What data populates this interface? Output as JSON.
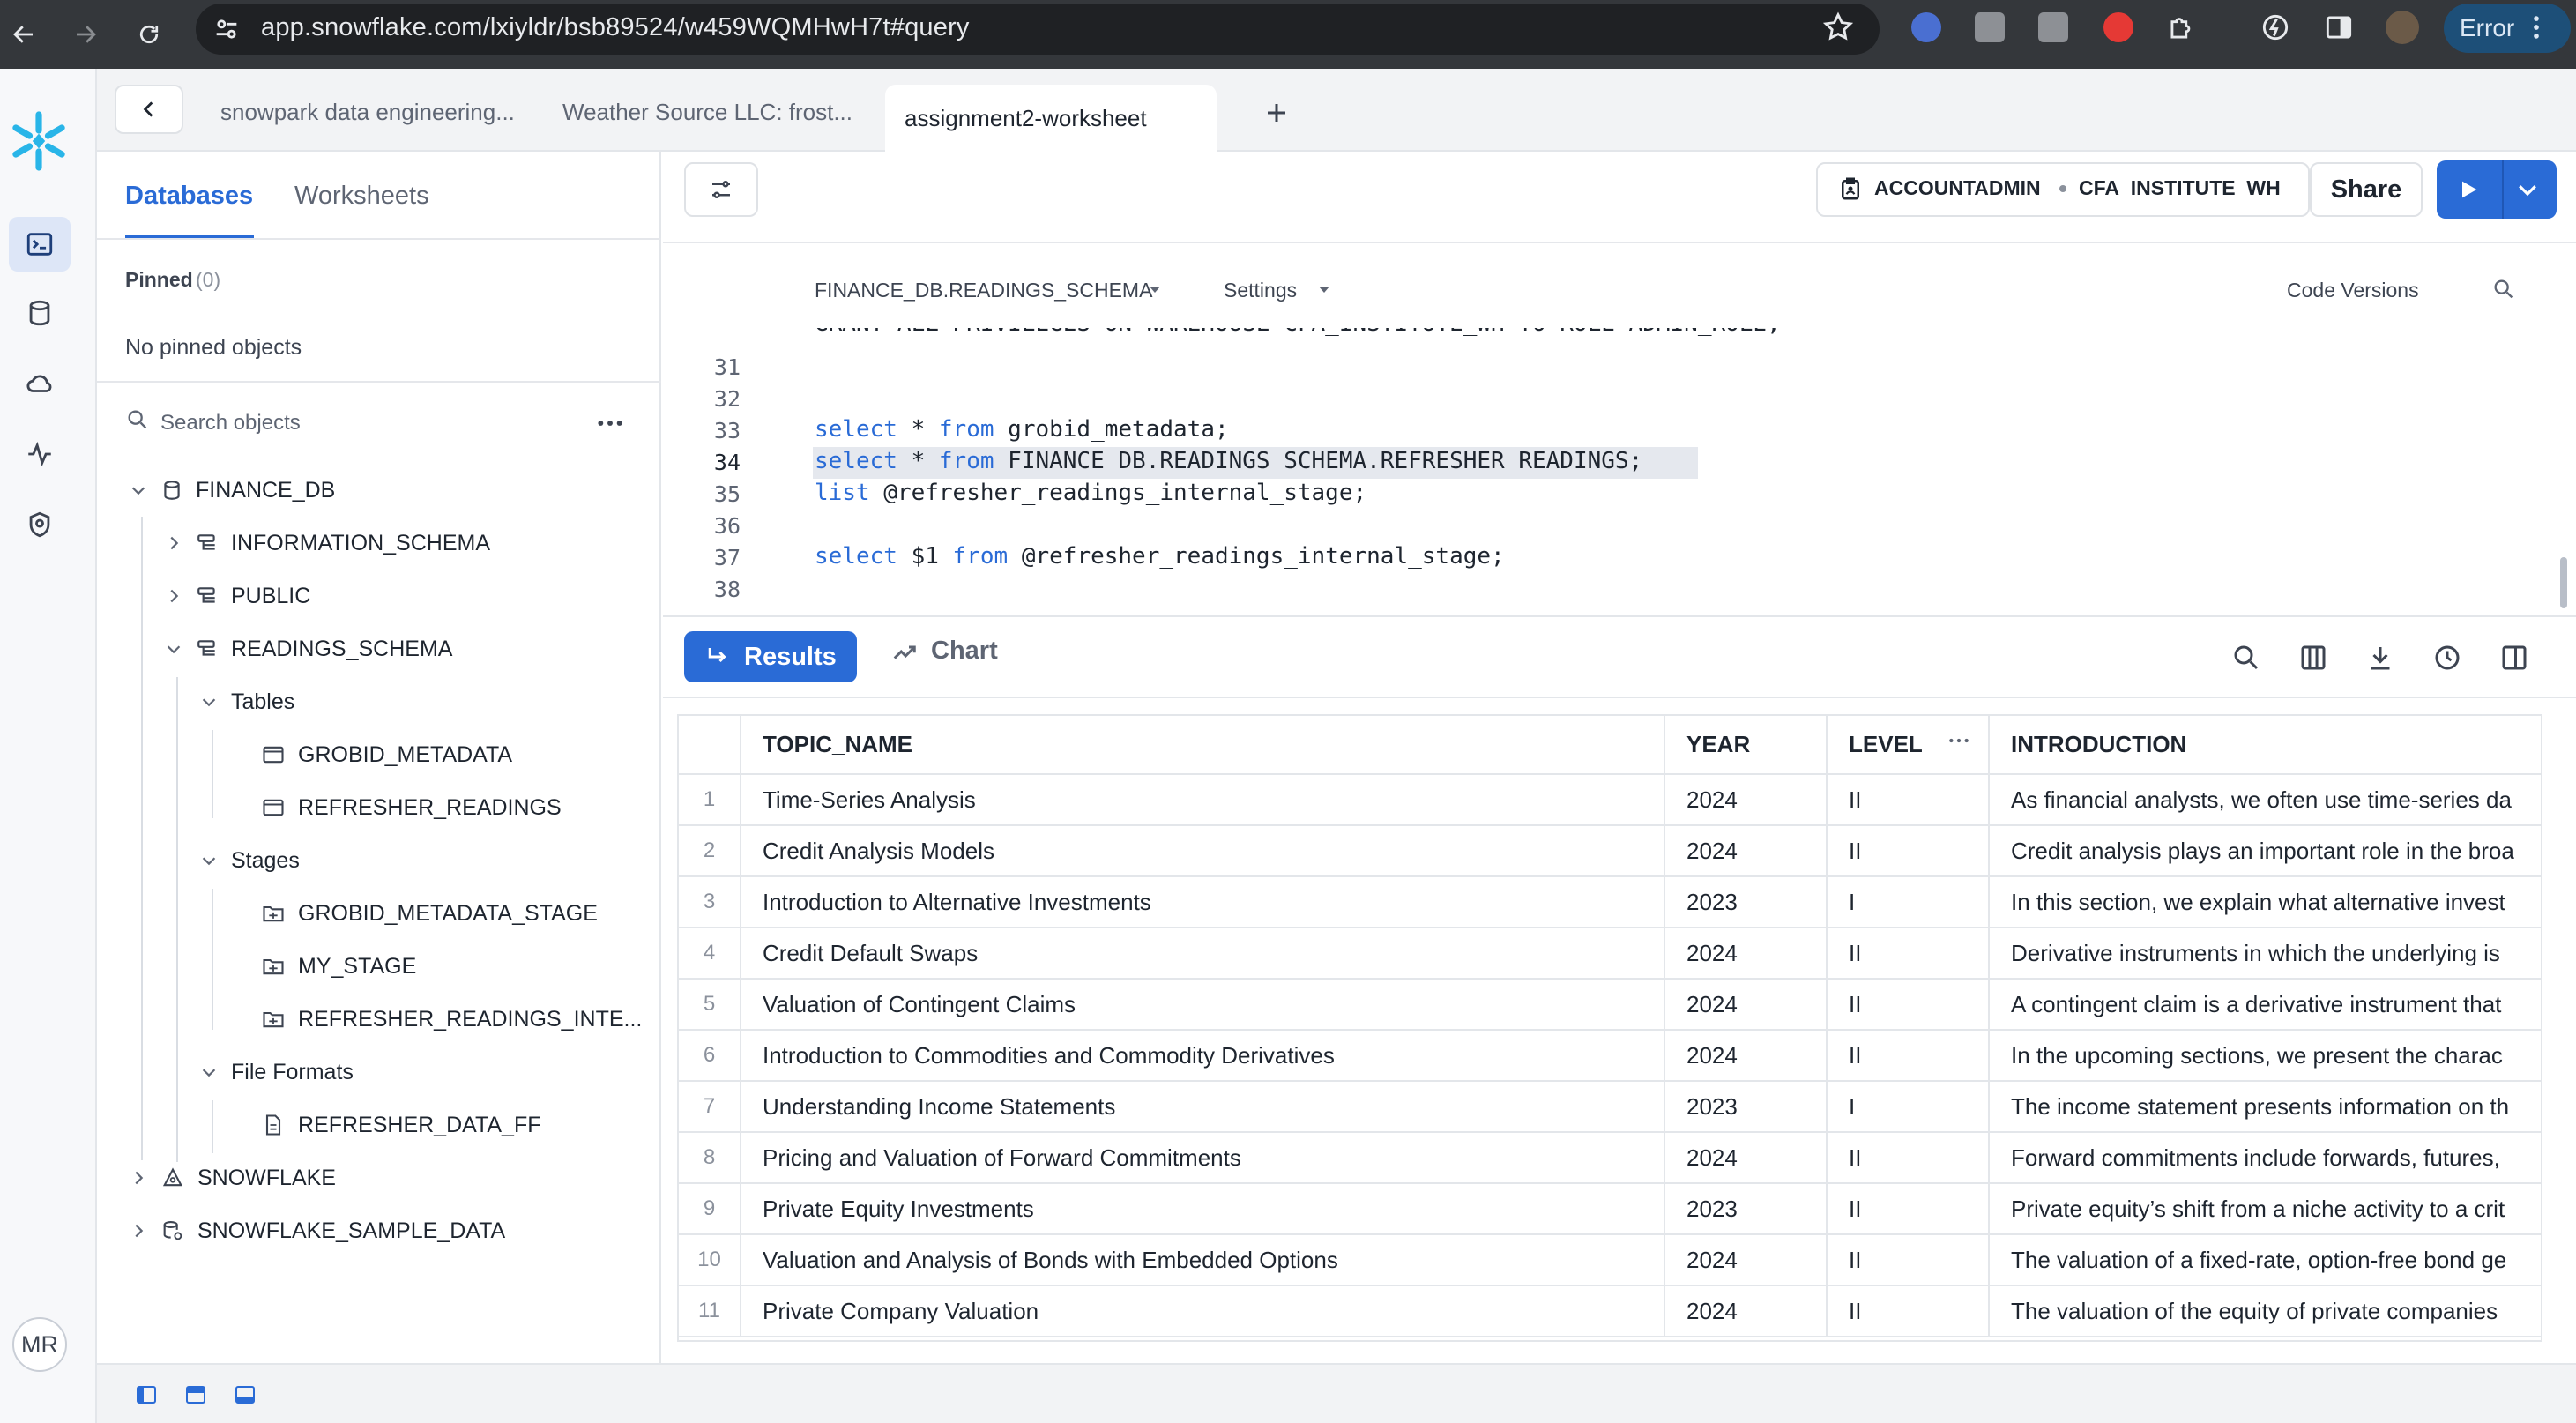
{
  "browser": {
    "url": "app.snowflake.com/lxiyldr/bsb89524/w459WQMHwH7t#query",
    "error_label": "Error"
  },
  "tabs": [
    {
      "label": "snowpark data engineering..."
    },
    {
      "label": "Weather Source LLC: frost..."
    },
    {
      "label": "assignment2-worksheet"
    }
  ],
  "sidebar": {
    "tab_databases": "Databases",
    "tab_worksheets": "Worksheets",
    "pinned_label": "Pinned",
    "pinned_count": "(0)",
    "no_pinned": "No pinned objects",
    "search_placeholder": "Search objects",
    "tree": {
      "finance_db": "FINANCE_DB",
      "information_schema": "INFORMATION_SCHEMA",
      "public": "PUBLIC",
      "readings_schema": "READINGS_SCHEMA",
      "tables": "Tables",
      "table_1": "GROBID_METADATA",
      "table_2": "REFRESHER_READINGS",
      "stages": "Stages",
      "stage_1": "GROBID_METADATA_STAGE",
      "stage_2": "MY_STAGE",
      "stage_3": "REFRESHER_READINGS_INTE...",
      "file_formats": "File Formats",
      "ff_1": "REFRESHER_DATA_FF",
      "snowflake": "SNOWFLAKE",
      "snowflake_sample": "SNOWFLAKE_SAMPLE_DATA"
    }
  },
  "user": {
    "initials": "MR"
  },
  "toolbar": {
    "role": "ACCOUNTADMIN",
    "warehouse": "CFA_INSTITUTE_WH",
    "share": "Share"
  },
  "editor": {
    "database_context": "FINANCE_DB.READINGS_SCHEMA",
    "settings": "Settings",
    "code_versions": "Code Versions",
    "partial_line": "GRANT ALL PRIVILEGES ON WAREHOUSE CFA_INSTITUTE_WH TO ROLE ADMIN_ROLE;",
    "lines": [
      {
        "num": "31",
        "kw": "",
        "rest": ""
      },
      {
        "num": "32",
        "kw": "",
        "rest": ""
      },
      {
        "num": "33",
        "kw": "select",
        "mid": " * ",
        "kw2": "from",
        "rest": " grobid_metadata;"
      },
      {
        "num": "34",
        "kw": "select",
        "mid": " * ",
        "kw2": "from",
        "rest": " FINANCE_DB.READINGS_SCHEMA.REFRESHER_READINGS;"
      },
      {
        "num": "35",
        "kw": "list",
        "mid": "",
        "kw2": "",
        "rest": " @refresher_readings_internal_stage;"
      },
      {
        "num": "36",
        "kw": "",
        "rest": ""
      },
      {
        "num": "37",
        "kw": "select",
        "mid": " $1 ",
        "kw2": "from",
        "rest": " @refresher_readings_internal_stage;"
      },
      {
        "num": "38",
        "kw": "",
        "rest": ""
      }
    ]
  },
  "results": {
    "results_label": "Results",
    "chart_label": "Chart",
    "columns": [
      "TOPIC_NAME",
      "YEAR",
      "LEVEL",
      "INTRODUCTION"
    ],
    "rows": [
      {
        "n": "1",
        "topic": "Time-Series Analysis",
        "year": "2024",
        "level": "II",
        "intro": "As financial analysts, we often use time-series da"
      },
      {
        "n": "2",
        "topic": "Credit Analysis Models",
        "year": "2024",
        "level": "II",
        "intro": "Credit analysis plays an important role in the broa"
      },
      {
        "n": "3",
        "topic": "Introduction to Alternative Investments",
        "year": "2023",
        "level": "I",
        "intro": "In this section, we explain what alternative invest"
      },
      {
        "n": "4",
        "topic": "Credit Default Swaps",
        "year": "2024",
        "level": "II",
        "intro": "Derivative instruments in which the underlying is"
      },
      {
        "n": "5",
        "topic": "Valuation of Contingent Claims",
        "year": "2024",
        "level": "II",
        "intro": "A contingent claim is a derivative instrument that"
      },
      {
        "n": "6",
        "topic": "Introduction to Commodities and Commodity Derivatives",
        "year": "2024",
        "level": "II",
        "intro": "In the upcoming sections, we present the charac"
      },
      {
        "n": "7",
        "topic": "Understanding Income Statements",
        "year": "2023",
        "level": "I",
        "intro": "The income statement presents information on th"
      },
      {
        "n": "8",
        "topic": "Pricing and Valuation of Forward Commitments",
        "year": "2024",
        "level": "II",
        "intro": "Forward commitments include forwards, futures,"
      },
      {
        "n": "9",
        "topic": "Private Equity Investments",
        "year": "2023",
        "level": "II",
        "intro": "Private equity’s shift from a niche activity to a crit"
      },
      {
        "n": "10",
        "topic": "Valuation and Analysis of Bonds with Embedded Options",
        "year": "2024",
        "level": "II",
        "intro": "The valuation of a fixed-rate, option-free bond ge"
      },
      {
        "n": "11",
        "topic": "Private Company Valuation",
        "year": "2024",
        "level": "II",
        "intro": "The valuation of the equity of private companies"
      }
    ]
  },
  "colors": {
    "accent": "#2a6bd6",
    "logo": "#29b5e8"
  }
}
